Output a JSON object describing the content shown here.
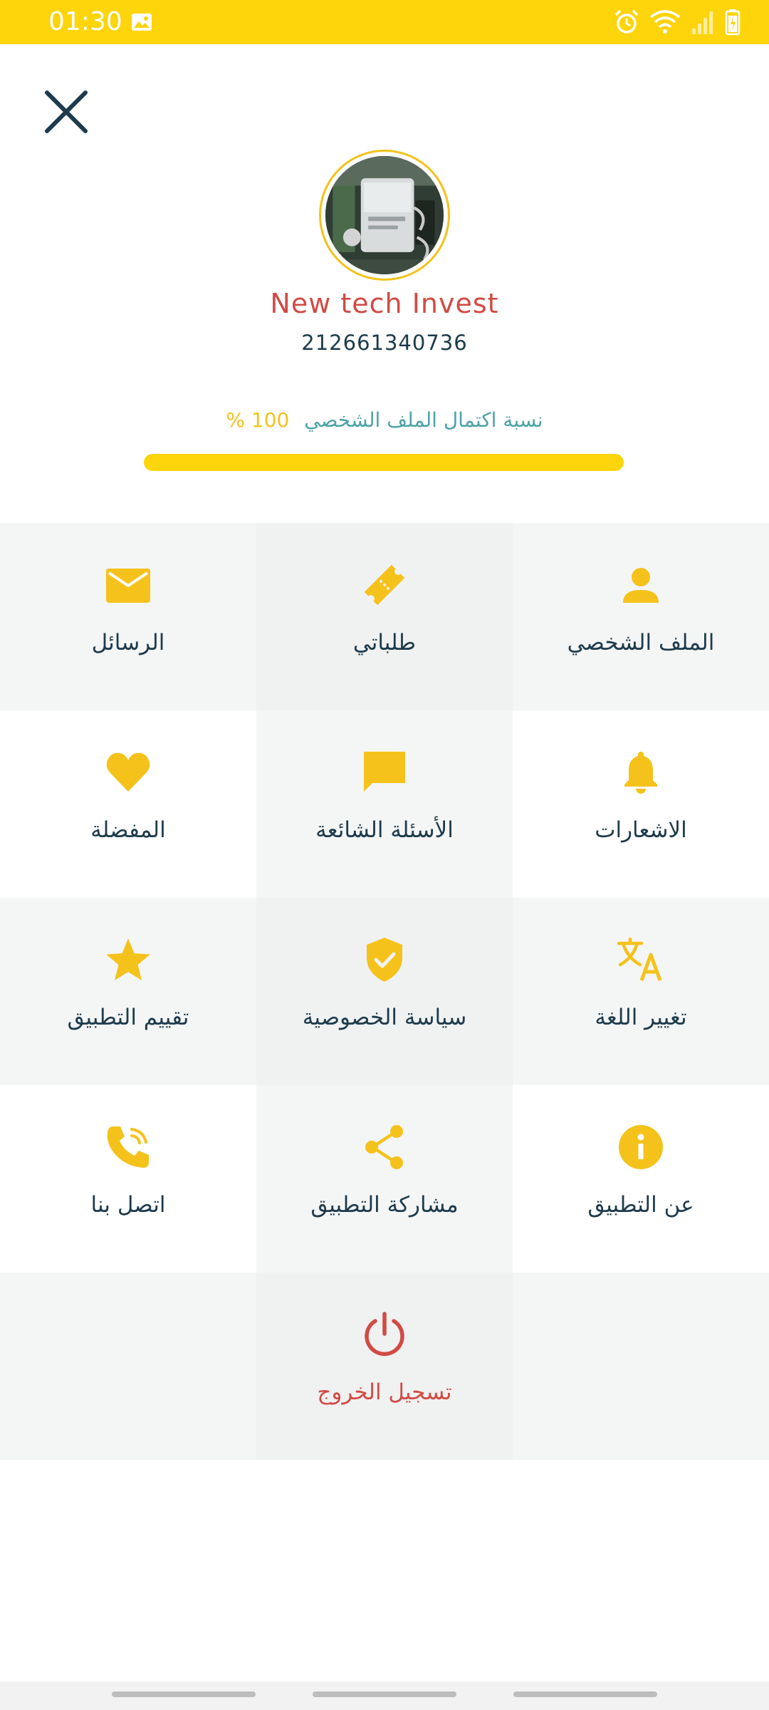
{
  "status_bar": {
    "time": "01:30",
    "icons": [
      "image-icon",
      "alarm-icon",
      "wifi-icon",
      "signal-icon",
      "battery-icon"
    ],
    "color": "#FED40A"
  },
  "close_icon": "close-icon",
  "profile": {
    "name": "New tech Invest",
    "phone": "212661340736",
    "completion_label": "نسبة اكتمال الملف الشخصي",
    "completion_value": "100 %",
    "completion_fraction": 1.0
  },
  "menu": [
    {
      "label": "الملف الشخصي",
      "icon": "person-icon"
    },
    {
      "label": "طلباتي",
      "icon": "ticket-icon"
    },
    {
      "label": "الرسائل",
      "icon": "mail-icon"
    },
    {
      "label": "الاشعارات",
      "icon": "bell-icon"
    },
    {
      "label": "الأسئلة الشائعة",
      "icon": "chat-icon"
    },
    {
      "label": "المفضلة",
      "icon": "heart-icon"
    },
    {
      "label": "تغيير اللغة",
      "icon": "translate-icon"
    },
    {
      "label": "سياسة الخصوصية",
      "icon": "shield-check-icon"
    },
    {
      "label": "تقييم التطبيق",
      "icon": "star-icon"
    },
    {
      "label": "عن التطبيق",
      "icon": "info-icon"
    },
    {
      "label": "مشاركة التطبيق",
      "icon": "share-icon"
    },
    {
      "label": "اتصل بنا",
      "icon": "phone-icon"
    },
    {
      "label": "",
      "icon": ""
    },
    {
      "label": "تسجيل الخروج",
      "icon": "power-icon"
    },
    {
      "label": "",
      "icon": ""
    }
  ],
  "colors": {
    "accent": "#FED40A",
    "icon": "#F4C21B",
    "text": "#1D3B4C",
    "logout": "#D14B44",
    "completion_label": "#4DA3A6"
  }
}
